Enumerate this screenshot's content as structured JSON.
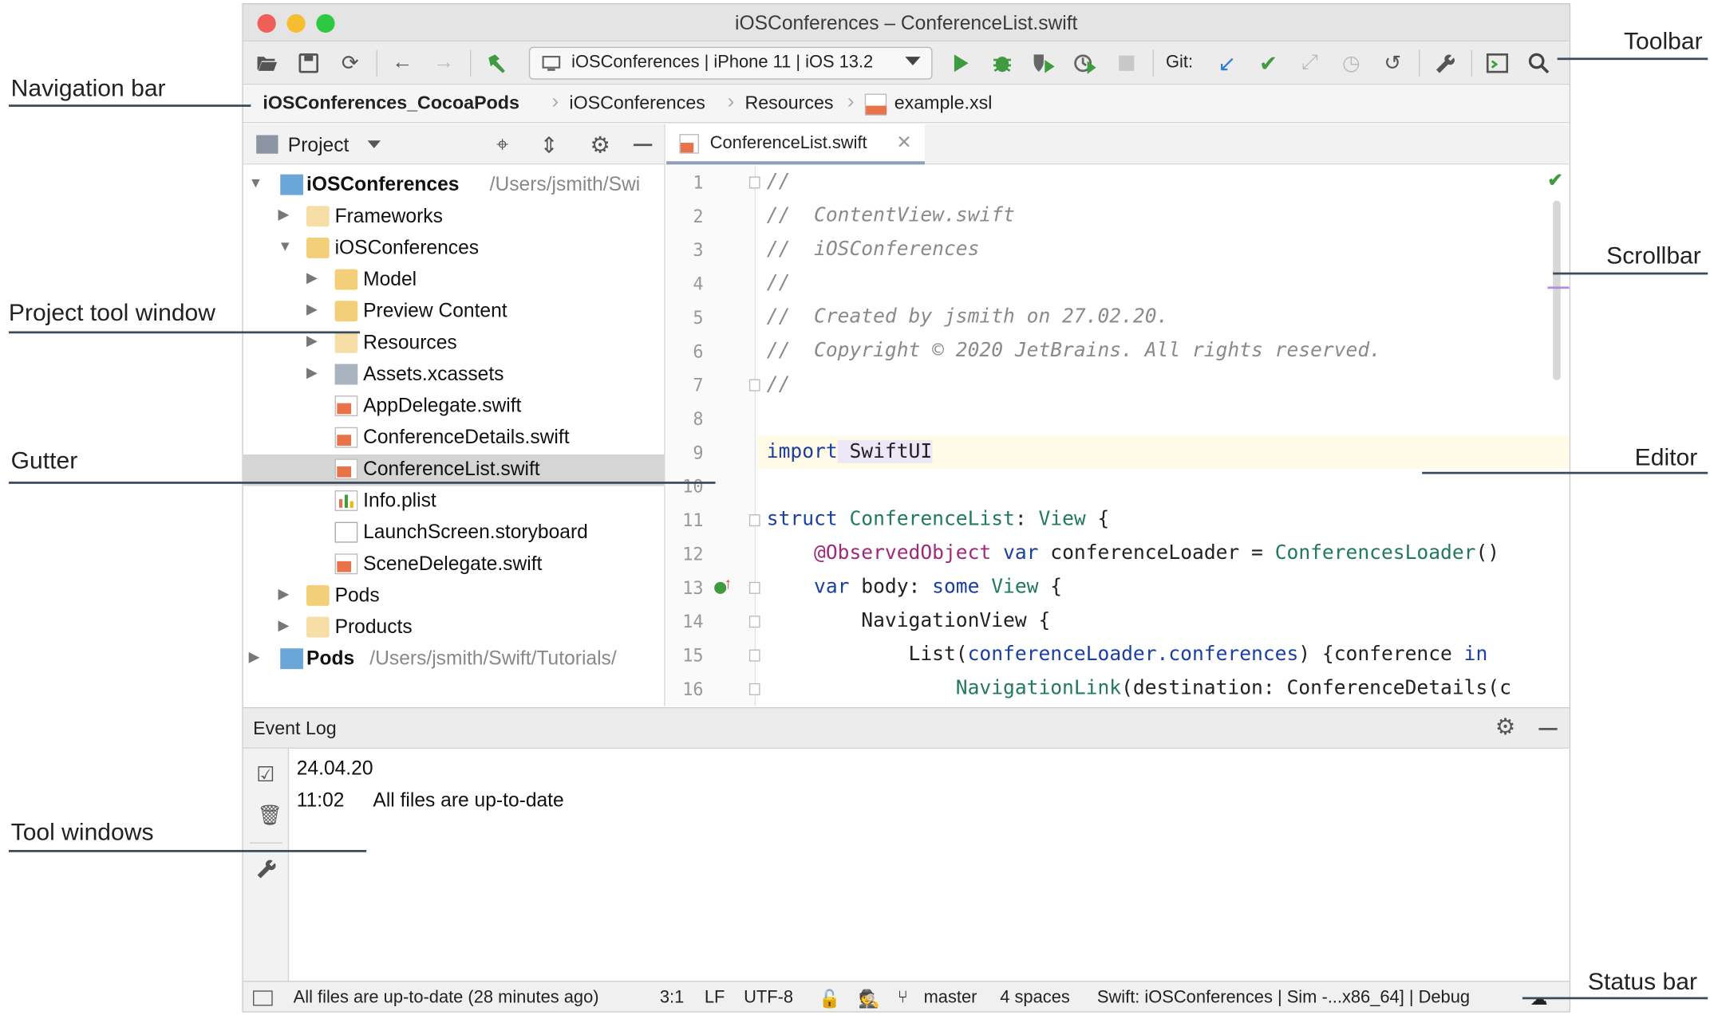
{
  "window": {
    "title": "iOSConferences – ConferenceList.swift",
    "traffic_colors": [
      "#ee5f57",
      "#f5bd2f",
      "#2ec941"
    ]
  },
  "toolbar": {
    "run_config": "iOSConferences | iPhone 11 | iOS 13.2",
    "git_label": "Git:",
    "icons": [
      "open-folder-icon",
      "save-icon",
      "sync-icon",
      "back-icon",
      "forward-icon",
      "build-hammer-icon",
      "run-icon",
      "debug-icon",
      "coverage-icon",
      "profile-icon",
      "stop-icon",
      "git-update-icon",
      "git-commit-icon",
      "git-merge-icon",
      "history-icon",
      "rollback-icon",
      "settings-wrench-icon",
      "terminal-icon",
      "search-icon"
    ]
  },
  "navbar": {
    "crumbs": [
      "iOSConferences_CocoaPods",
      "iOSConferences",
      "Resources",
      "example.xsl"
    ]
  },
  "project": {
    "header_label": "Project",
    "tree": [
      {
        "label": "iOSConferences",
        "path": "/Users/jsmith/Swi",
        "kind": "module",
        "expanded": true
      },
      {
        "label": "Frameworks",
        "kind": "folder-light",
        "expanded": false
      },
      {
        "label": "iOSConferences",
        "kind": "folder",
        "expanded": true
      },
      {
        "label": "Model",
        "kind": "folder",
        "expanded": false
      },
      {
        "label": "Preview Content",
        "kind": "folder",
        "expanded": false
      },
      {
        "label": "Resources",
        "kind": "folder",
        "expanded": false
      },
      {
        "label": "Assets.xcassets",
        "kind": "assets",
        "expanded": false
      },
      {
        "label": "AppDelegate.swift",
        "kind": "swift"
      },
      {
        "label": "ConferenceDetails.swift",
        "kind": "swift"
      },
      {
        "label": "ConferenceList.swift",
        "kind": "swift",
        "selected": true
      },
      {
        "label": "Info.plist",
        "kind": "plist"
      },
      {
        "label": "LaunchScreen.storyboard",
        "kind": "storyboard"
      },
      {
        "label": "SceneDelegate.swift",
        "kind": "swift"
      },
      {
        "label": "Pods",
        "kind": "folder",
        "expanded": false
      },
      {
        "label": "Products",
        "kind": "folder-light",
        "expanded": false
      },
      {
        "label": "Pods",
        "path": "/Users/jsmith/Swift/Tutorials/",
        "kind": "module",
        "expanded": false
      }
    ]
  },
  "editor": {
    "tab_label": "ConferenceList.swift",
    "line_numbers": [
      "1",
      "2",
      "3",
      "4",
      "5",
      "6",
      "7",
      "8",
      "9",
      "10",
      "11",
      "12",
      "13",
      "14",
      "15",
      "16"
    ],
    "code": {
      "l1": "//",
      "l2": "//  ContentView.swift",
      "l3": "//  iOSConferences",
      "l4": "//",
      "l5": "//  Created by jsmith on 27.02.20.",
      "l6": "//  Copyright © 2020 JetBrains. All rights reserved.",
      "l7": "//",
      "l9_kw": "import",
      "l9_rest": " SwiftUI",
      "l11_kw": "struct",
      "l11_name": " ConferenceList",
      "l11_colon": ": ",
      "l11_type": "View",
      "l11_end": " {",
      "l12_attr": "    @ObservedObject",
      "l12_kw": " var",
      "l12_rest": " conferenceLoader = ",
      "l12_type": "ConferencesLoader",
      "l12_end": "()",
      "l13_kw": "    var",
      "l13_rest": " body: ",
      "l13_kw2": "some",
      "l13_type": " View",
      "l13_end": " {",
      "l14": "        NavigationView {",
      "l15_a": "            List(",
      "l15_b": "conferenceLoader.conferences",
      "l15_c": ") {conference ",
      "l15_kw": "in",
      "l16_a": "                NavigationLink",
      "l16_b": "(destination: ConferenceDetails(c"
    }
  },
  "event_log": {
    "title": "Event Log",
    "date": "24.04.20",
    "time": "11:02",
    "message": "All files are up-to-date"
  },
  "status_bar": {
    "message": "All files are up-to-date (28 minutes ago)",
    "position": "3:1",
    "line_sep": "LF",
    "encoding": "UTF-8",
    "branch": "master",
    "indent": "4 spaces",
    "context": "Swift: iOSConferences | Sim -...x86_64] | Debug"
  },
  "callouts": {
    "navigation_bar": "Navigation bar",
    "project_tool_window": "Project tool window",
    "gutter": "Gutter",
    "tool_windows": "Tool windows",
    "toolbar": "Toolbar",
    "scrollbar": "Scrollbar",
    "editor": "Editor",
    "status_bar": "Status bar"
  }
}
